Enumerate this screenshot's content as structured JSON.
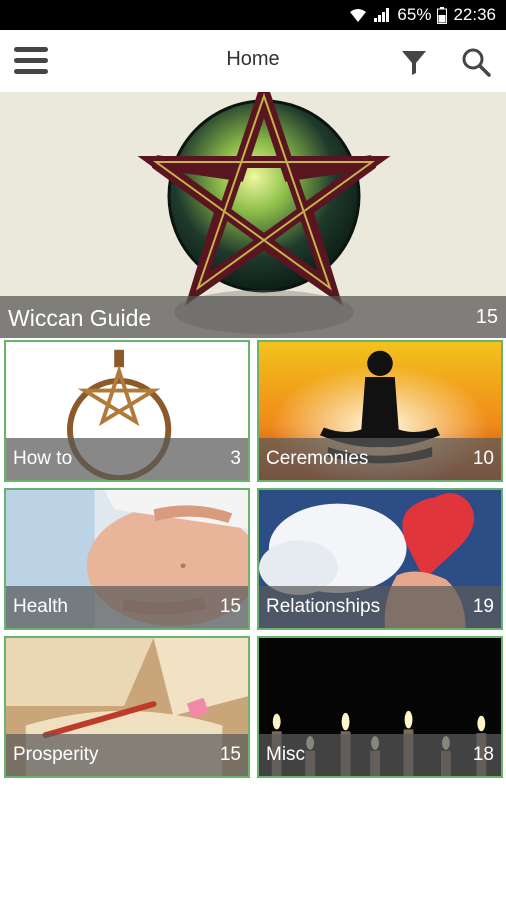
{
  "status": {
    "battery": "65%",
    "time": "22:36"
  },
  "appbar": {
    "title": "Home"
  },
  "hero": {
    "label": "Wiccan Guide",
    "count": "15"
  },
  "tiles": [
    {
      "label": "How to",
      "count": "3"
    },
    {
      "label": "Ceremonies",
      "count": "10"
    },
    {
      "label": "Health",
      "count": "15"
    },
    {
      "label": "Relationships",
      "count": "19"
    },
    {
      "label": "Prosperity",
      "count": "15"
    },
    {
      "label": "Misc",
      "count": "18"
    }
  ],
  "colors": {
    "accent_border": "#6ab36e",
    "caption_overlay": "#5a5a5a",
    "status_bar": "#000000"
  }
}
